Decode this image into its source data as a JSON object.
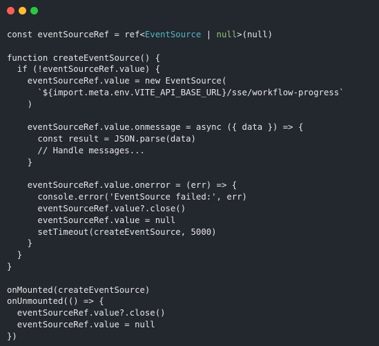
{
  "window": {
    "buttons": [
      "close",
      "minimize",
      "maximize"
    ]
  },
  "code": {
    "lines": [
      "const eventSourceRef = ref<EventSource | null>(null)",
      "",
      "function createEventSource() {",
      "  if (!eventSourceRef.value) {",
      "    eventSourceRef.value = new EventSource(",
      "      `${import.meta.env.VITE_API_BASE_URL}/sse/workflow-progress`",
      "    )",
      "",
      "    eventSourceRef.value.onmessage = async ({ data }) => {",
      "      const result = JSON.parse(data)",
      "      // Handle messages...",
      "    }",
      "",
      "    eventSourceRef.value.onerror = (err) => {",
      "      console.error('EventSource failed:', err)",
      "      eventSourceRef.value?.close()",
      "      eventSourceRef.value = null",
      "      setTimeout(createEventSource, 5000)",
      "    }",
      "  }",
      "}",
      "",
      "onMounted(createEventSource)",
      "onUnmounted(() => {",
      "  eventSourceRef.value?.close()",
      "  eventSourceRef.value = null",
      "})"
    ],
    "first_line_parts": {
      "before": "const eventSourceRef = ref<",
      "type1": "EventSource",
      "sep": " | ",
      "type2": "null",
      "after": ">(null)"
    }
  },
  "colors": {
    "background": "#23272e",
    "text": "#e6e6e6",
    "type_accent": "#56b6c2",
    "null_accent": "#98c379",
    "close": "#ff5f56",
    "minimize": "#ffbd2e",
    "maximize": "#27c93f"
  }
}
